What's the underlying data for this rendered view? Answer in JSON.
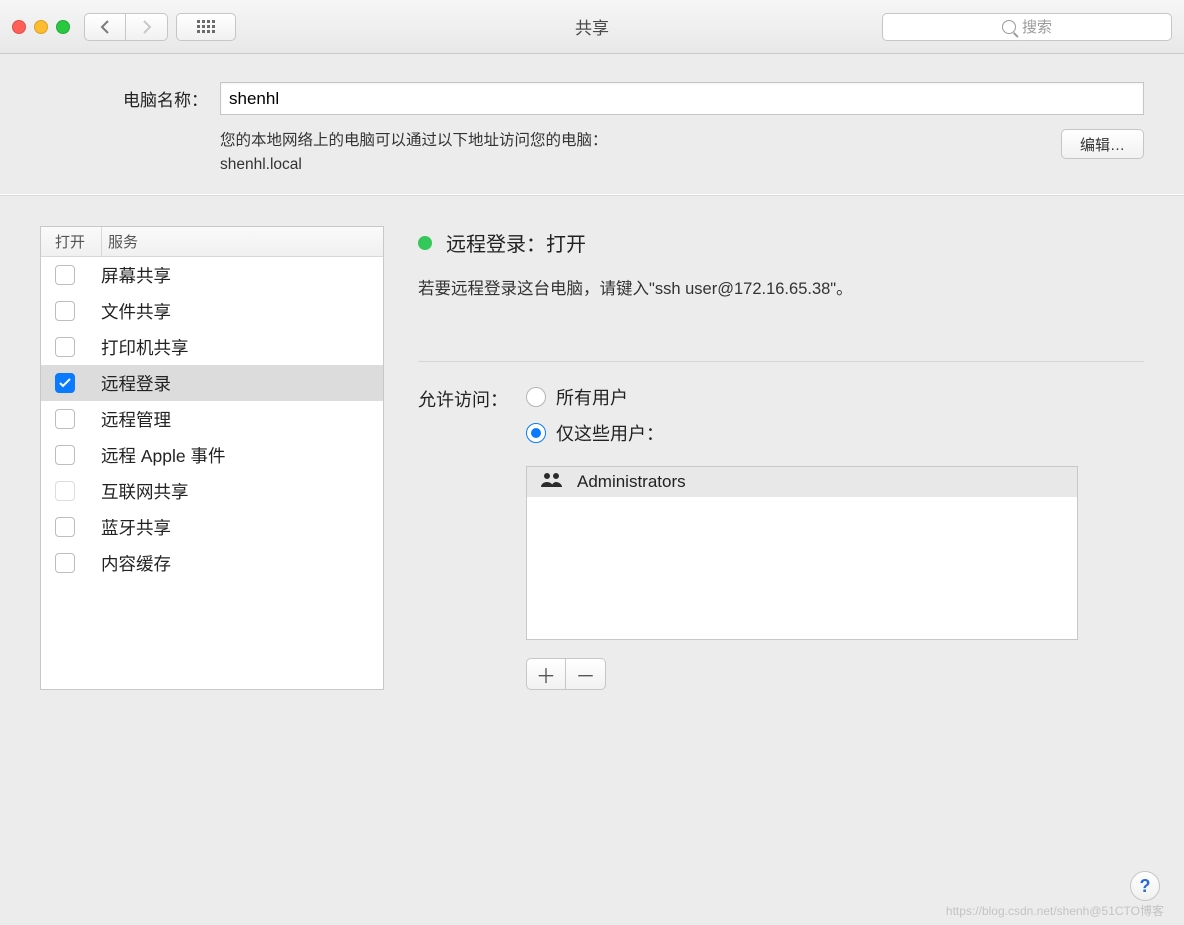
{
  "window": {
    "title": "共享",
    "search_placeholder": "搜索"
  },
  "computer_name": {
    "label": "电脑名称：",
    "value": "shenhl",
    "description_line1": "您的本地网络上的电脑可以通过以下地址访问您的电脑：",
    "description_line2": "shenhl.local",
    "edit_button": "编辑…"
  },
  "services": {
    "header_on": "打开",
    "header_service": "服务",
    "items": [
      {
        "label": "屏幕共享",
        "checked": false,
        "selected": false,
        "dimmed": false
      },
      {
        "label": "文件共享",
        "checked": false,
        "selected": false,
        "dimmed": false
      },
      {
        "label": "打印机共享",
        "checked": false,
        "selected": false,
        "dimmed": false
      },
      {
        "label": "远程登录",
        "checked": true,
        "selected": true,
        "dimmed": false
      },
      {
        "label": "远程管理",
        "checked": false,
        "selected": false,
        "dimmed": false
      },
      {
        "label": "远程 Apple 事件",
        "checked": false,
        "selected": false,
        "dimmed": false
      },
      {
        "label": "互联网共享",
        "checked": false,
        "selected": false,
        "dimmed": true
      },
      {
        "label": "蓝牙共享",
        "checked": false,
        "selected": false,
        "dimmed": false
      },
      {
        "label": "内容缓存",
        "checked": false,
        "selected": false,
        "dimmed": false
      }
    ]
  },
  "detail": {
    "status_label": "远程登录：打开",
    "status_color": "#34c759",
    "instruction": "若要远程登录这台电脑，请键入\"ssh user@172.16.65.38\"。",
    "allow_label": "允许访问：",
    "radio_all": "所有用户",
    "radio_only": "仅这些用户：",
    "selected_option": "only",
    "users": [
      "Administrators"
    ]
  },
  "help_label": "?",
  "watermark": "https://blog.csdn.net/shenh@51CTO博客"
}
